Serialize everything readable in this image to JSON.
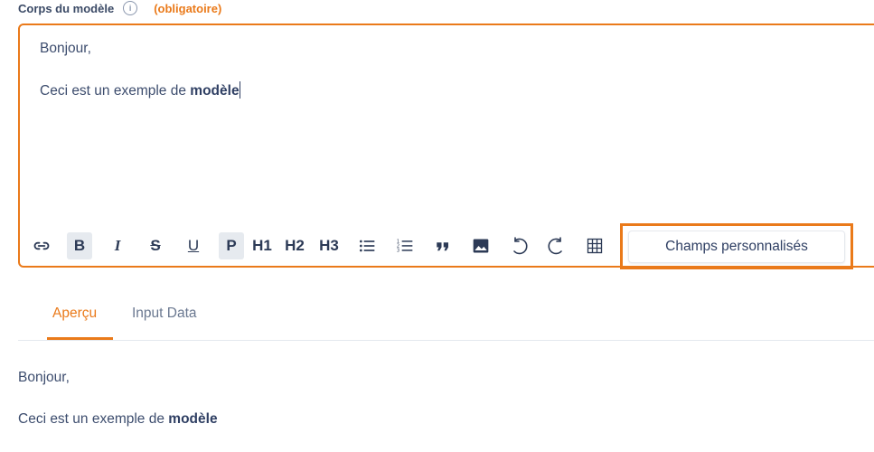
{
  "field": {
    "label": "Corps du modèle",
    "info_icon": "i",
    "required": "(obligatoire)"
  },
  "editor": {
    "line1": "Bonjour,",
    "line2_prefix": "Ceci est un exemple de ",
    "line2_bold": "modèle"
  },
  "toolbar": {
    "bold": "B",
    "italic": "I",
    "strike": "S",
    "underline": "U",
    "paragraph": "P",
    "h1": "H1",
    "h2": "H2",
    "h3": "H3",
    "quote": "”",
    "custom_fields": "Champs personnalisés",
    "icons": [
      "link-icon",
      "bullet-list-icon",
      "numbered-list-icon",
      "quote-icon",
      "image-icon",
      "undo-icon",
      "redo-icon",
      "table-icon"
    ]
  },
  "tabs": [
    {
      "label": "Aperçu",
      "active": true
    },
    {
      "label": "Input Data",
      "active": false
    }
  ],
  "preview": {
    "line1": "Bonjour,",
    "line2_prefix": "Ceci est un exemple de ",
    "line2_bold": "modèle"
  },
  "colors": {
    "accent": "#ea7a1a",
    "text": "#3d4d6e"
  }
}
